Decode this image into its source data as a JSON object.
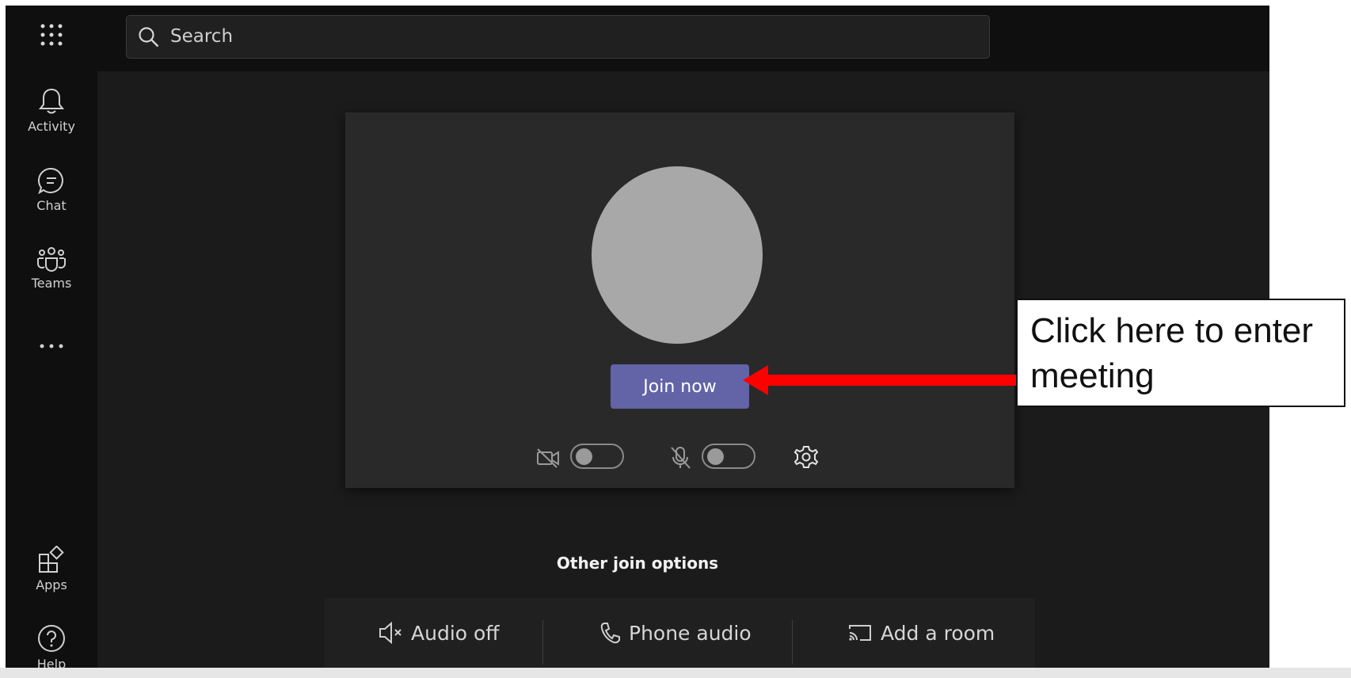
{
  "app": {
    "theme_background": "#0f0f0f",
    "accent": "#6264a7"
  },
  "search": {
    "placeholder": "Search",
    "icon": "search-icon"
  },
  "rail": {
    "launcher_icon": "app-launcher-icon",
    "items": [
      {
        "label": "Activity",
        "icon": "bell-icon"
      },
      {
        "label": "Chat",
        "icon": "chat-icon"
      },
      {
        "label": "Teams",
        "icon": "teams-icon"
      },
      {
        "label": "",
        "icon": "more-icon"
      },
      {
        "label": "Apps",
        "icon": "apps-icon"
      },
      {
        "label": "Help",
        "icon": "help-icon"
      }
    ]
  },
  "lobby": {
    "join_button": "Join now",
    "camera_enabled": false,
    "mic_enabled": false,
    "settings_icon": "gear-icon"
  },
  "other_join": {
    "title": "Other join options",
    "options": [
      {
        "label": "Audio off",
        "icon": "speaker-off-icon"
      },
      {
        "label": "Phone audio",
        "icon": "phone-icon"
      },
      {
        "label": "Add a room",
        "icon": "cast-icon"
      }
    ]
  },
  "annotation": {
    "text": "Click here to enter meeting",
    "arrow_color": "#ff0000"
  }
}
